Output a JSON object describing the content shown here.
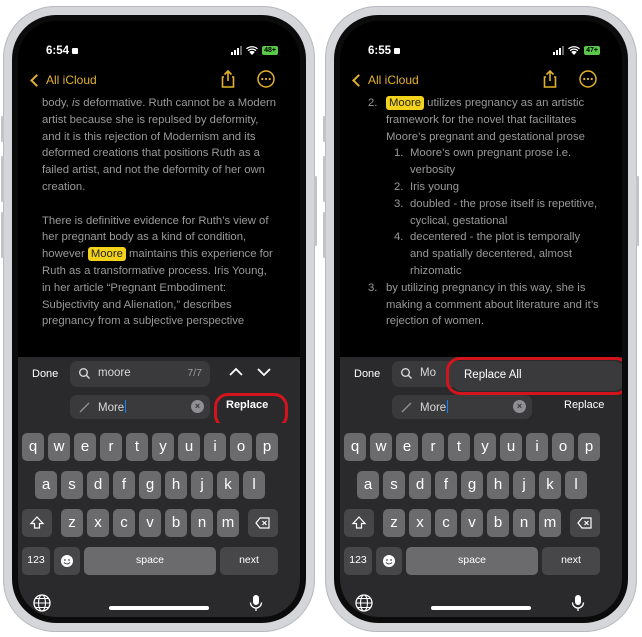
{
  "colors": {
    "accent": "#e3b12c",
    "highlight": "#f3d21c",
    "annotation": "#d4141c"
  },
  "left": {
    "time": "6:54",
    "battery": "48+",
    "back_label": "All iCloud",
    "note": {
      "p1_a": "body, ",
      "p1_b": "is",
      "p1_c": " deformative. Ruth cannot be a Modern artist because she is repulsed by deformity, and it is this rejection of Modernism and its deformed creations that positions Ruth as a failed artist, and not the deformity of her own creation.",
      "p2_a": "There is definitive evidence for Ruth’s view of her pregnant body as a kind of condition, however ",
      "p2_hl": "Moore",
      "p2_b": " maintains this experience for Ruth as a transformative process. Iris Young, in her article “Pregnant Embodiment: Subjectivity and Alienation,” describes pregnancy from a subjective perspective"
    },
    "find": {
      "done": "Done",
      "query": "moore",
      "count": "7/7",
      "replace_value": "More",
      "replace_label": "Replace"
    }
  },
  "right": {
    "time": "6:55",
    "battery": "47+",
    "back_label": "All iCloud",
    "note": {
      "item2_num": "2.",
      "item2_hl": "Moore",
      "item2_text": " utilizes pregnancy as an artistic framework for the novel that facilitates Moore’s pregnant and gestational prose",
      "subitems": [
        {
          "num": "1.",
          "text": "Moore’s own pregnant prose i.e. verbosity"
        },
        {
          "num": "2.",
          "text": "Iris young"
        },
        {
          "num": "3.",
          "text": "doubled - the prose itself is repetitive, cyclical, gestational"
        },
        {
          "num": "4.",
          "text": "decentered - the plot is temporally and spatially decentered, almost rhizomatic"
        }
      ],
      "item3_num": "3.",
      "item3_text": "by utilizing pregnancy in this way, she is making a comment about literature and it’s rejection of women."
    },
    "find": {
      "done": "Done",
      "query": "Mo",
      "replace_all_label": "Replace All",
      "replace_value": "More",
      "replace_label": "Replace"
    }
  },
  "keyboard": {
    "row1": [
      "q",
      "w",
      "e",
      "r",
      "t",
      "y",
      "u",
      "i",
      "o",
      "p"
    ],
    "row2": [
      "a",
      "s",
      "d",
      "f",
      "g",
      "h",
      "j",
      "k",
      "l"
    ],
    "row3": [
      "z",
      "x",
      "c",
      "v",
      "b",
      "n",
      "m"
    ],
    "numbers_label": "123",
    "space_label": "space",
    "next_label": "next"
  },
  "icons": [
    "chevron-left-icon",
    "share-icon",
    "more-icon",
    "search-icon",
    "chevron-up-icon",
    "chevron-down-icon",
    "pencil-icon",
    "clear-icon",
    "shift-icon",
    "delete-icon",
    "emoji-icon",
    "globe-icon",
    "microphone-icon"
  ]
}
